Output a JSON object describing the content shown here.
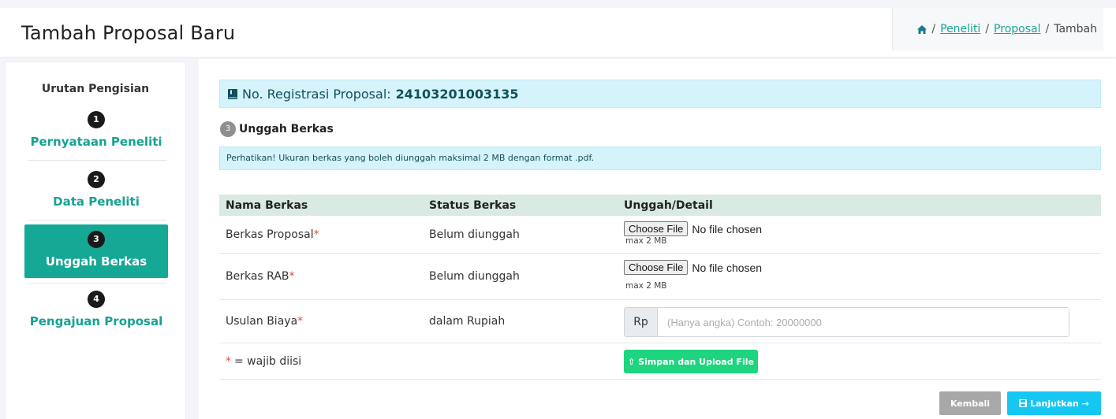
{
  "header": {
    "title": "Tambah Proposal Baru",
    "breadcrumb": [
      {
        "label": "Peneliti"
      },
      {
        "label": "Proposal"
      },
      {
        "label": "Tambah"
      }
    ],
    "breadcrumb_sep": "/"
  },
  "sidebar": {
    "heading": "Urutan Pengisian",
    "steps": [
      {
        "num": "1",
        "label": "Pernyataan Peneliti"
      },
      {
        "num": "2",
        "label": "Data Peneliti"
      },
      {
        "num": "3",
        "label": "Unggah Berkas",
        "active": true
      },
      {
        "num": "4",
        "label": "Pengajuan Proposal"
      }
    ]
  },
  "main": {
    "registration": {
      "label": "No. Registrasi Proposal:",
      "number": "24103201003135"
    },
    "section": {
      "num": "3",
      "title": "Unggah Berkas"
    },
    "notice": "Perhatikan! Ukuran berkas yang boleh diunggah maksimal 2 MB dengan format .pdf.",
    "table": {
      "headers": [
        "Nama Berkas",
        "Status Berkas",
        "Unggah/Detail"
      ],
      "rows": [
        {
          "name": "Berkas Proposal",
          "status": "Belum diunggah",
          "choose": "Choose File",
          "nofile": "No file chosen",
          "max": "max 2 MB"
        },
        {
          "name": "Berkas RAB",
          "status": "Belum diunggah",
          "choose": "Choose File",
          "nofile": "No file chosen",
          "max": "max 2 MB"
        }
      ],
      "cost": {
        "name": "Usulan Biaya",
        "status": "dalam Rupiah",
        "addon": "Rp",
        "placeholder": "(Hanya angka) Contoh: 20000000"
      },
      "required_mark": "*",
      "required_note": "= wajib diisi",
      "save_button": "⇧ Simpan dan Upload File"
    },
    "buttons": {
      "back": "Kembali",
      "next": "Lanjutkan →"
    }
  },
  "colors": {
    "teal": "#16a293",
    "active_step": "#14a895",
    "info_bg": "#d4f3fb",
    "save_green": "#1ed47f",
    "next_blue": "#16c7f2",
    "back_gray": "#a8a8a8"
  }
}
